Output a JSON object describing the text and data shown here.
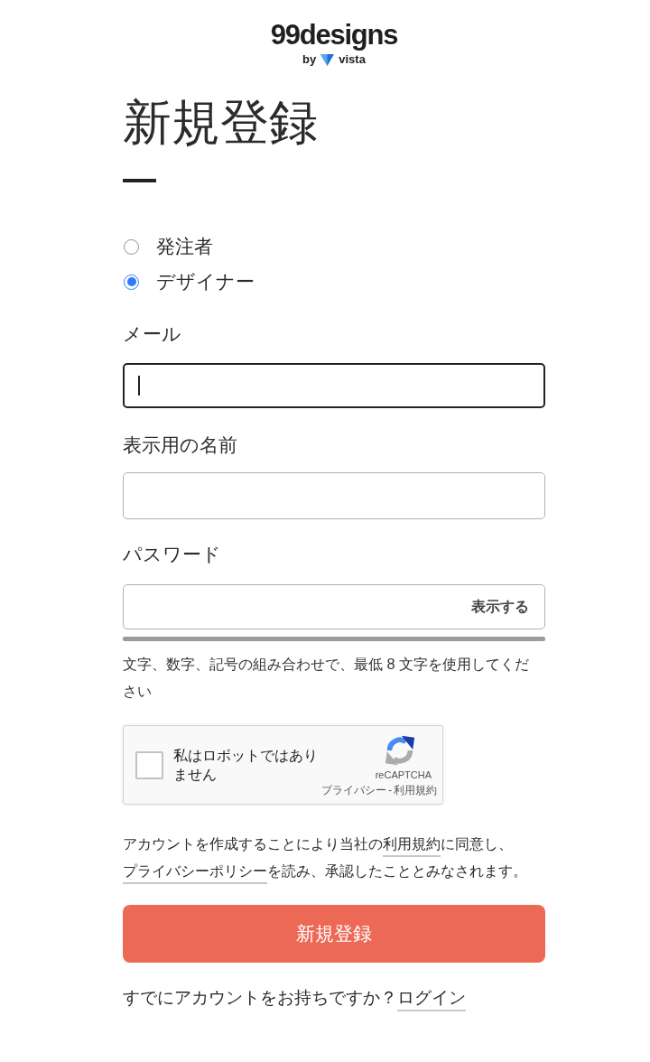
{
  "logo": {
    "wordmark": "99designs",
    "byline": "by",
    "partner": "vista"
  },
  "page_title": "新規登録",
  "role_options": [
    {
      "label": "発注者",
      "selected": false
    },
    {
      "label": "デザイナー",
      "selected": true
    }
  ],
  "fields": [
    {
      "kind": "email",
      "label": "メール",
      "focused": true
    },
    {
      "kind": "text",
      "label": "表示用の名前",
      "focused": false
    },
    {
      "kind": "password",
      "label": "パスワード",
      "focused": false,
      "toggle": "表示する"
    }
  ],
  "password_hint": "文字、数字、記号の組み合わせで、最低 8 文字を使用してください",
  "captcha": {
    "label": "私はロボットではありません",
    "checked": false,
    "brand": "reCAPTCHA",
    "links": [
      "プライバシー",
      "利用規約"
    ],
    "separator": "-"
  },
  "terms": [
    {
      "kind": "text",
      "text": "アカウントを作成することにより当社の"
    },
    {
      "kind": "link",
      "text": "利用規約"
    },
    {
      "kind": "text",
      "text": "に同意し、"
    },
    {
      "kind": "link",
      "text": "プライバシーポリシー"
    },
    {
      "kind": "text",
      "text": "を読み、承認したこととみなされます。"
    }
  ],
  "submit_button": "新規登録",
  "login_prompt": {
    "text": "すでにアカウントをお持ちですか？",
    "link": "ログイン"
  }
}
